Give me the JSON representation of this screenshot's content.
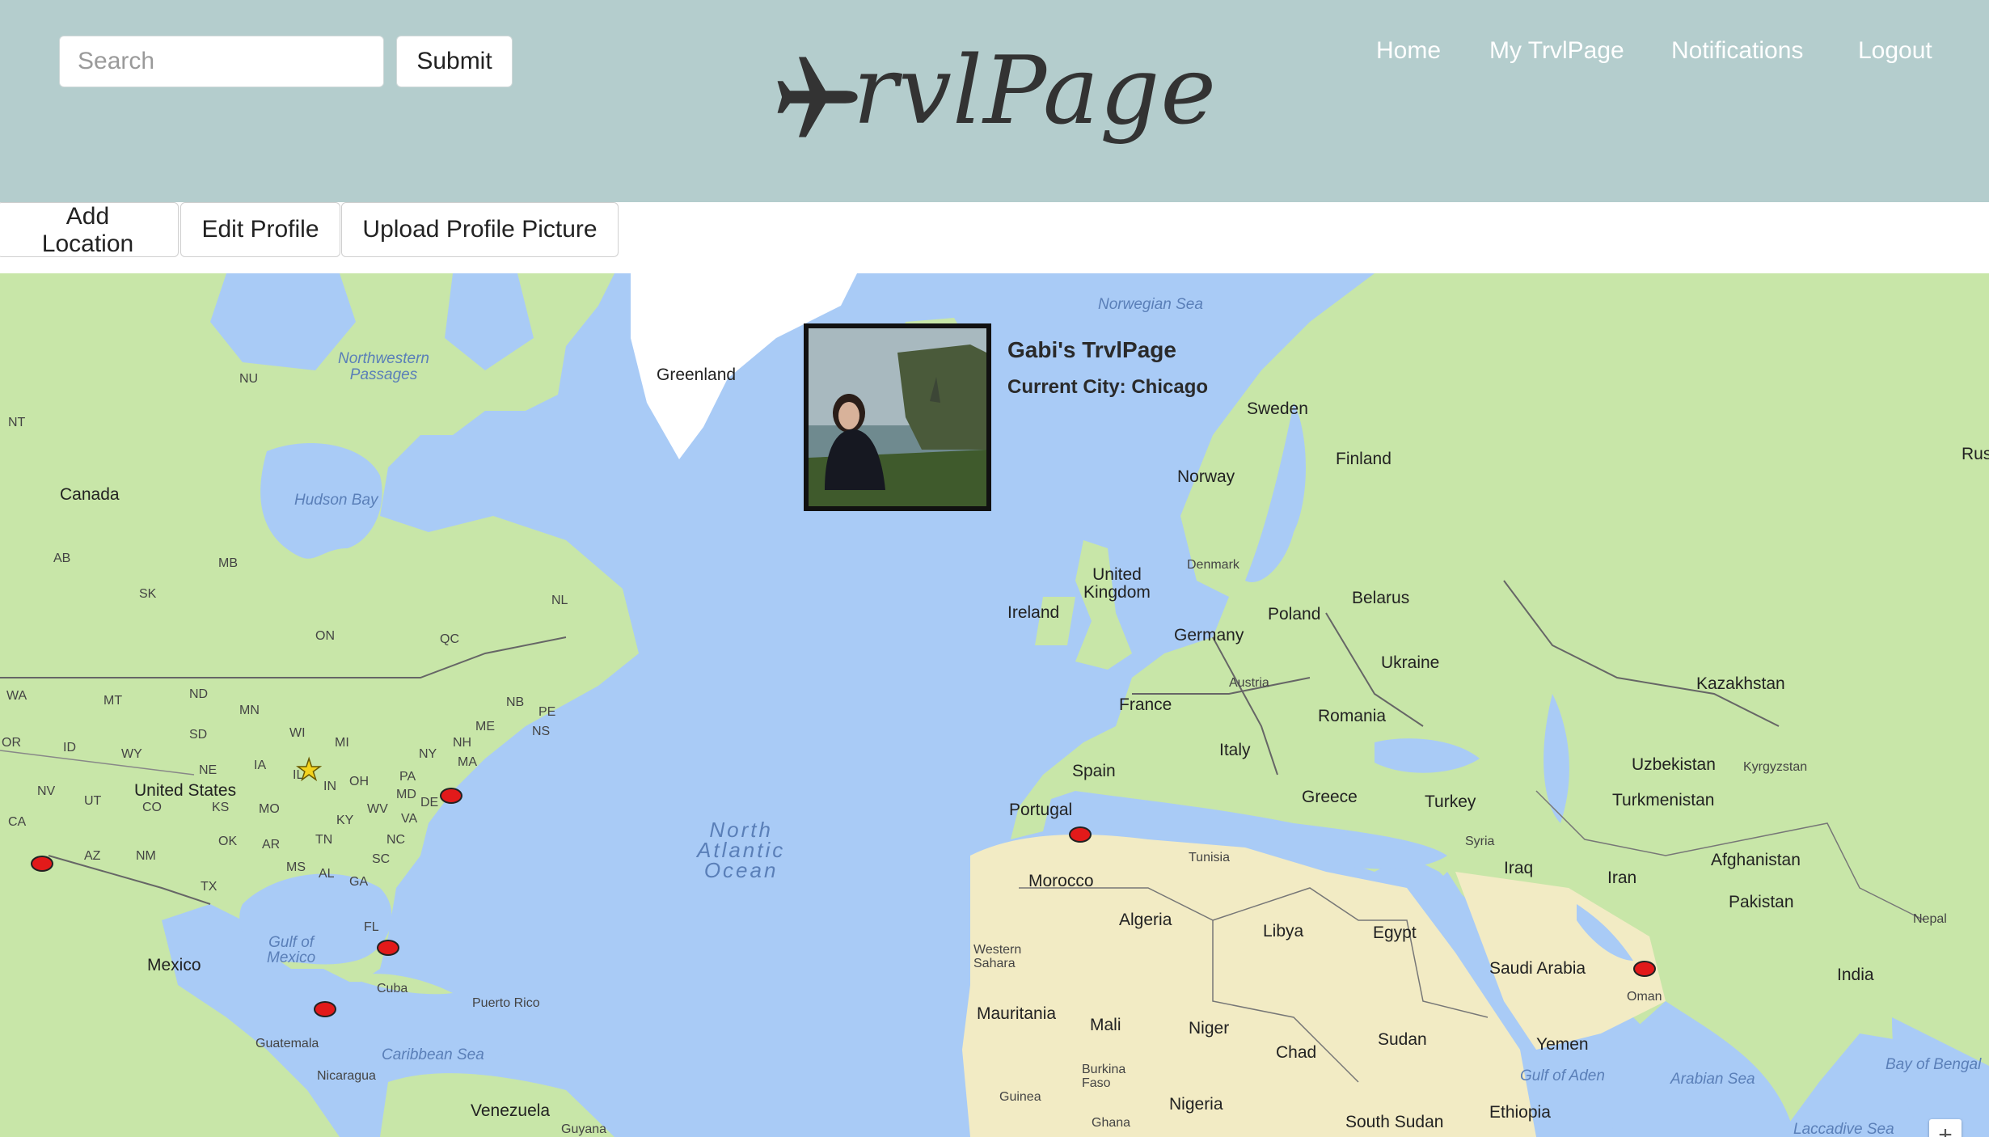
{
  "header": {
    "search_placeholder": "Search",
    "submit_label": "Submit",
    "logo_text": "rvlPage",
    "nav": {
      "home": "Home",
      "my_page": "My TrvlPage",
      "notifications": "Notifications",
      "logout": "Logout"
    }
  },
  "toolbar": {
    "add_location": "Add Location",
    "edit_profile": "Edit Profile",
    "upload_picture": "Upload Profile Picture"
  },
  "profile": {
    "title": "Gabi's TrvlPage",
    "current_city": "Current City: Chicago"
  },
  "map": {
    "labels": {
      "greenland": "Greenland",
      "canada": "Canada",
      "united_states": "United States",
      "mexico": "Mexico",
      "cuba": "Cuba",
      "puerto_rico": "Puerto Rico",
      "guatemala": "Guatemala",
      "nicaragua": "Nicaragua",
      "venezuela": "Venezuela",
      "guyana": "Guyana",
      "sweden": "Sweden",
      "finland": "Finland",
      "norway": "Norway",
      "denmark": "Denmark",
      "united_kingdom": "United\nKingdom",
      "ireland": "Ireland",
      "poland": "Poland",
      "belarus": "Belarus",
      "germany": "Germany",
      "ukraine": "Ukraine",
      "austria": "Austria",
      "france": "France",
      "romania": "Romania",
      "italy": "Italy",
      "spain": "Spain",
      "portugal": "Portugal",
      "greece": "Greece",
      "turkey": "Turkey",
      "kazakhstan": "Kazakhstan",
      "uzbekistan": "Uzbekistan",
      "kyrgyzstan": "Kyrgyzstan",
      "turkmenistan": "Turkmenistan",
      "syria": "Syria",
      "iraq": "Iraq",
      "iran": "Iran",
      "afghanistan": "Afghanistan",
      "pakistan": "Pakistan",
      "nepal": "Nepal",
      "india": "India",
      "tunisia": "Tunisia",
      "morocco": "Morocco",
      "algeria": "Algeria",
      "libya": "Libya",
      "egypt": "Egypt",
      "western_sahara": "Western\nSahara",
      "saudi_arabia": "Saudi Arabia",
      "oman": "Oman",
      "yemen": "Yemen",
      "mauritania": "Mauritania",
      "mali": "Mali",
      "niger": "Niger",
      "chad": "Chad",
      "sudan": "Sudan",
      "burkina_faso": "Burkina\nFaso",
      "nigeria": "Nigeria",
      "guinea": "Guinea",
      "ghana": "Ghana",
      "south_sudan": "South Sudan",
      "ethiopia": "Ethiopia",
      "rus": "Rus",
      "nu": "NU",
      "nt": "NT",
      "ab": "AB",
      "mb": "MB",
      "sk": "SK",
      "on": "ON",
      "qc": "QC",
      "nl": "NL",
      "wa": "WA",
      "mt": "MT",
      "nd": "ND",
      "mn": "MN",
      "sd": "SD",
      "wi": "WI",
      "mi": "MI",
      "or": "OR",
      "id": "ID",
      "wy": "WY",
      "ne": "NE",
      "ia": "IA",
      "nv": "NV",
      "ut": "UT",
      "co": "CO",
      "ks": "KS",
      "mo": "MO",
      "il": "IL",
      "in": "IN",
      "oh": "OH",
      "pa": "PA",
      "ny": "NY",
      "nh": "NH",
      "me": "ME",
      "ma": "MA",
      "nb": "NB",
      "pe": "PE",
      "ns": "NS",
      "md": "MD",
      "de": "DE",
      "wv": "WV",
      "va": "VA",
      "ky": "KY",
      "nc": "NC",
      "tn": "TN",
      "sc": "SC",
      "ar": "AR",
      "ok": "OK",
      "ms": "MS",
      "al": "AL",
      "ga": "GA",
      "ca": "CA",
      "az": "AZ",
      "nm": "NM",
      "tx": "TX",
      "fl": "FL",
      "norwegian_sea": "Norwegian Sea",
      "northwestern_passages": "Northwestern\nPassages",
      "hudson_bay": "Hudson Bay",
      "gulf_of_mexico": "Gulf of\nMexico",
      "caribbean_sea": "Caribbean Sea",
      "gulf_of_aden": "Gulf of Aden",
      "arabian_sea": "Arabian Sea",
      "bay_of_bengal": "Bay of Bengal",
      "lacca": "Laccadive Sea",
      "north_atlantic": "North\nAtlantic\nOcean"
    },
    "zoom_label": "+"
  }
}
